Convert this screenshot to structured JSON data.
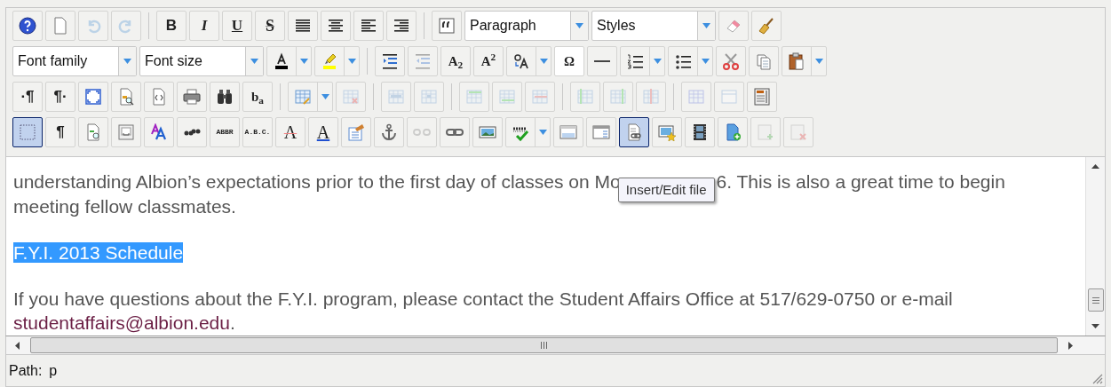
{
  "toolbars": [
    {
      "items": [
        {
          "kind": "button",
          "disabled": false,
          "selected": false
        },
        {
          "kind": "button",
          "disabled": false,
          "selected": false
        },
        {
          "kind": "button",
          "disabled": true,
          "selected": false
        },
        {
          "kind": "button",
          "disabled": true,
          "selected": false
        },
        {
          "kind": "separator"
        },
        {
          "kind": "text-button",
          "label": "B",
          "disabled": false,
          "selected": false
        },
        {
          "kind": "text-button",
          "label": "I",
          "disabled": false,
          "selected": false
        },
        {
          "kind": "text-button",
          "label": "U",
          "disabled": false,
          "selected": false
        },
        {
          "kind": "text-button",
          "label": "S",
          "disabled": false,
          "selected": false
        },
        {
          "kind": "button",
          "disabled": false,
          "selected": false
        },
        {
          "kind": "button",
          "disabled": false,
          "selected": false
        },
        {
          "kind": "button",
          "disabled": false,
          "selected": false
        },
        {
          "kind": "button",
          "disabled": false,
          "selected": false
        },
        {
          "kind": "separator"
        },
        {
          "kind": "button",
          "disabled": false,
          "selected": false
        },
        {
          "kind": "select",
          "label": "Paragraph"
        },
        {
          "kind": "select",
          "label": "Styles"
        },
        {
          "kind": "button",
          "disabled": false,
          "selected": false
        },
        {
          "kind": "button",
          "disabled": false,
          "selected": false
        }
      ]
    },
    {
      "items": [
        {
          "kind": "select",
          "label": "Font family"
        },
        {
          "kind": "select",
          "label": "Font size"
        },
        {
          "kind": "split",
          "disabled": false
        },
        {
          "kind": "split",
          "disabled": false
        },
        {
          "kind": "separator"
        },
        {
          "kind": "button",
          "disabled": false,
          "selected": false
        },
        {
          "kind": "button",
          "disabled": true,
          "selected": false
        },
        {
          "kind": "text-button",
          "label": "A$_{2}$",
          "disabled": false,
          "selected": false
        },
        {
          "kind": "text-button",
          "label": "A$^{2}$",
          "disabled": false,
          "selected": false
        },
        {
          "kind": "split",
          "disabled": false
        },
        {
          "kind": "text-button",
          "label": "Ω",
          "disabled": false,
          "selected": false
        },
        {
          "kind": "button",
          "disabled": false,
          "selected": false
        },
        {
          "kind": "split",
          "disabled": false
        },
        {
          "kind": "split",
          "disabled": false
        },
        {
          "kind": "button",
          "disabled": false,
          "selected": false
        },
        {
          "kind": "button",
          "disabled": false,
          "selected": false
        },
        {
          "kind": "split",
          "disabled": false
        }
      ]
    },
    {
      "items": [
        {
          "kind": "text-button",
          "label": "·¶",
          "disabled": false,
          "selected": false
        },
        {
          "kind": "text-button",
          "label": "¶·",
          "disabled": false,
          "selected": false
        },
        {
          "kind": "button",
          "disabled": false,
          "selected": false
        },
        {
          "kind": "button",
          "disabled": false,
          "selected": false
        },
        {
          "kind": "button",
          "disabled": false,
          "selected": false
        },
        {
          "kind": "button",
          "disabled": false,
          "selected": false
        },
        {
          "kind": "button",
          "disabled": false,
          "selected": false
        },
        {
          "kind": "text-button",
          "label": "b$_{a}$",
          "disabled": false,
          "selected": false
        },
        {
          "kind": "separator"
        },
        {
          "kind": "split",
          "disabled": false
        },
        {
          "kind": "button",
          "disabled": true,
          "selected": false
        },
        {
          "kind": "separator"
        },
        {
          "kind": "button",
          "disabled": true,
          "selected": false
        },
        {
          "kind": "button",
          "disabled": true,
          "selected": false
        },
        {
          "kind": "separator"
        },
        {
          "kind": "button",
          "disabled": true,
          "selected": false
        },
        {
          "kind": "button",
          "disabled": true,
          "selected": false
        },
        {
          "kind": "button",
          "disabled": true,
          "selected": false
        },
        {
          "kind": "separator"
        },
        {
          "kind": "button",
          "disabled": true,
          "selected": false
        },
        {
          "kind": "button",
          "disabled": true,
          "selected": false
        },
        {
          "kind": "button",
          "disabled": true,
          "selected": false
        },
        {
          "kind": "separator"
        },
        {
          "kind": "button",
          "disabled": true,
          "selected": false
        },
        {
          "kind": "button",
          "disabled": true,
          "selected": false
        },
        {
          "kind": "button",
          "disabled": false,
          "selected": false
        }
      ]
    },
    {
      "items": [
        {
          "kind": "button",
          "disabled": false,
          "selected": true
        },
        {
          "kind": "text-button",
          "label": "¶",
          "disabled": false,
          "selected": false
        },
        {
          "kind": "button",
          "disabled": false,
          "selected": false
        },
        {
          "kind": "button",
          "disabled": false,
          "selected": false
        },
        {
          "kind": "button",
          "disabled": false,
          "selected": false
        },
        {
          "kind": "button",
          "disabled": false,
          "selected": false
        },
        {
          "kind": "text-button",
          "label": "ABBR",
          "disabled": false,
          "selected": false
        },
        {
          "kind": "text-button",
          "label": "A.B.C.",
          "disabled": false,
          "selected": false
        },
        {
          "kind": "text-button",
          "label": "A",
          "disabled": false,
          "selected": false
        },
        {
          "kind": "text-button",
          "label": "A",
          "disabled": false,
          "selected": false
        },
        {
          "kind": "button",
          "disabled": false,
          "selected": false
        },
        {
          "kind": "button",
          "disabled": false,
          "selected": false
        },
        {
          "kind": "button",
          "disabled": true,
          "selected": false
        },
        {
          "kind": "button",
          "disabled": false,
          "selected": false
        },
        {
          "kind": "button",
          "disabled": false,
          "selected": false
        },
        {
          "kind": "split",
          "disabled": false
        },
        {
          "kind": "button",
          "disabled": false,
          "selected": false
        },
        {
          "kind": "button",
          "disabled": false,
          "selected": false
        },
        {
          "kind": "button",
          "disabled": false,
          "selected": true
        },
        {
          "kind": "button",
          "disabled": false,
          "selected": false
        },
        {
          "kind": "button",
          "disabled": false,
          "selected": false
        },
        {
          "kind": "button",
          "disabled": false,
          "selected": false
        },
        {
          "kind": "button",
          "disabled": true,
          "selected": false
        },
        {
          "kind": "button",
          "disabled": true,
          "selected": false
        }
      ]
    }
  ],
  "document": {
    "paragraph_1": {
      "before_tooltip": "understanding Albion’s expectations prior to the first day of classes on Mo",
      "after_tooltip": "6. This is also a great time to begin",
      "continuation": "meeting fellow classmates."
    },
    "tooltip": "Insert/Edit file",
    "heading": {
      "text": "F.Y.I. 2013 Schedule",
      "selected": true
    },
    "paragraph_2": {
      "text": "If you have questions about the F.Y.I. program, please contact the Student Affairs Office at 517/629-0750 or e-mail ",
      "link": "studentaffairs@albion.edu",
      "after": "."
    }
  },
  "status_bar": {
    "path_label": "Path:",
    "path": "p"
  }
}
